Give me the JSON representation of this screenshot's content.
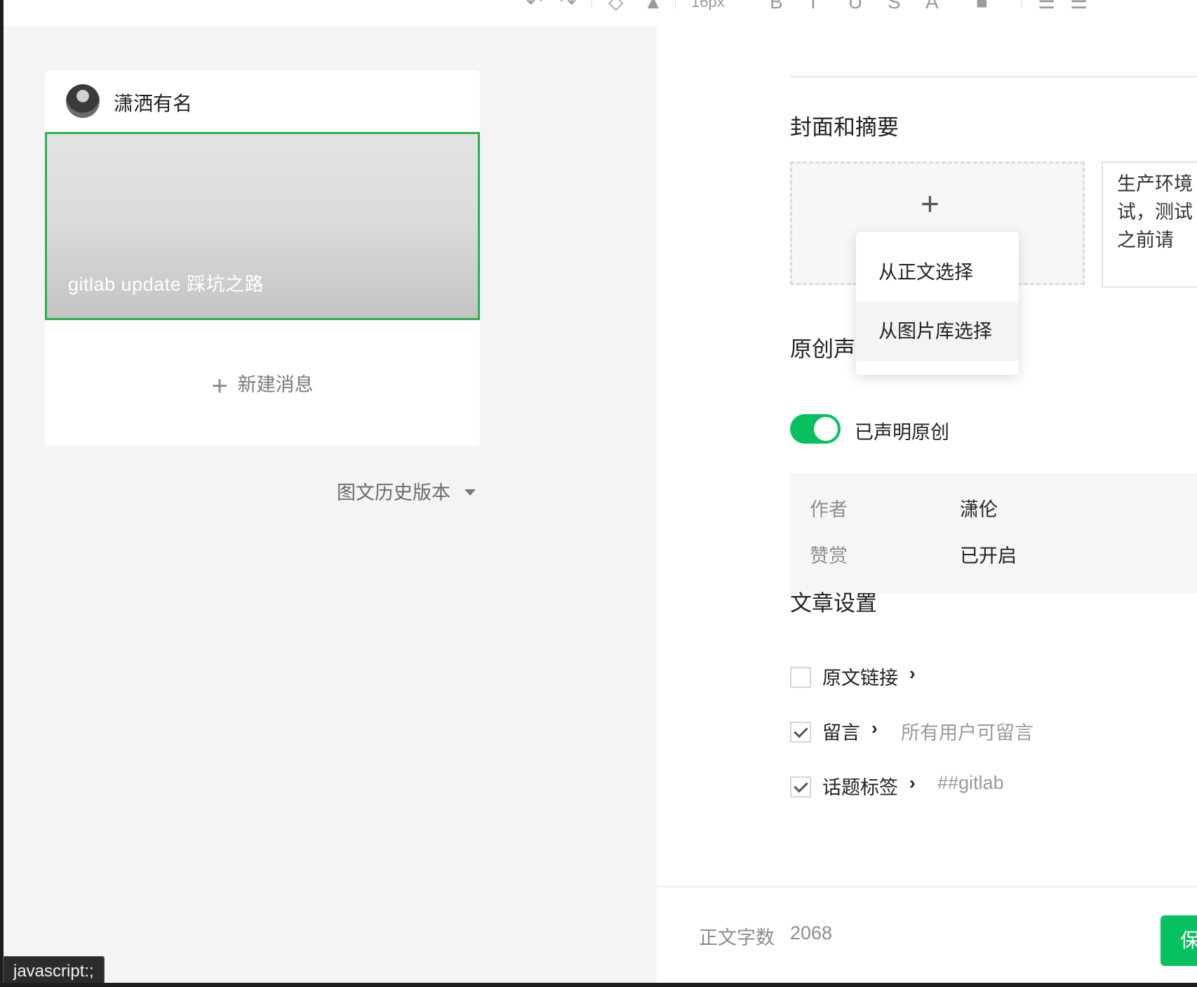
{
  "toolbar": {
    "font_size": "16px",
    "icons": [
      "undo-icon",
      "redo-icon",
      "clear-format-icon",
      "format-painter-icon",
      "font-size-select",
      "bold-icon",
      "italic-icon",
      "underline-icon",
      "strikethrough-icon",
      "font-color-icon",
      "background-color-icon",
      "align-icon",
      "line-height-icon"
    ]
  },
  "account": {
    "name": "潇洒有名"
  },
  "article": {
    "title": "gitlab update  踩坑之路"
  },
  "new_message": {
    "label": "新建消息"
  },
  "history": {
    "label": "图文历史版本"
  },
  "tooltip": {
    "text": "javascript:;"
  },
  "cover_section": {
    "title": "封面和摘要",
    "summary_lines": [
      "生产环境",
      "试，测试",
      "之前请"
    ],
    "dropdown": [
      "从正文选择",
      "从图片库选择"
    ]
  },
  "original_section": {
    "title": "原创声明",
    "toggle_label": "已声明原创",
    "toggle_on": true,
    "rows": [
      {
        "key": "作者",
        "value": "潇伦"
      },
      {
        "key": "赞赏",
        "value": "已开启"
      }
    ]
  },
  "settings_section": {
    "title": "文章设置",
    "items": [
      {
        "label": "原文链接",
        "checked": false,
        "value": ""
      },
      {
        "label": "留言",
        "checked": true,
        "value": "所有用户可留言"
      },
      {
        "label": "话题标签",
        "checked": true,
        "value": "##gitlab"
      }
    ]
  },
  "footer": {
    "wordcount_label": "正文字数",
    "wordcount_value": "2068",
    "save_label": "保存"
  },
  "colors": {
    "accent": "#07c160",
    "selected_border": "#2bb24c"
  }
}
